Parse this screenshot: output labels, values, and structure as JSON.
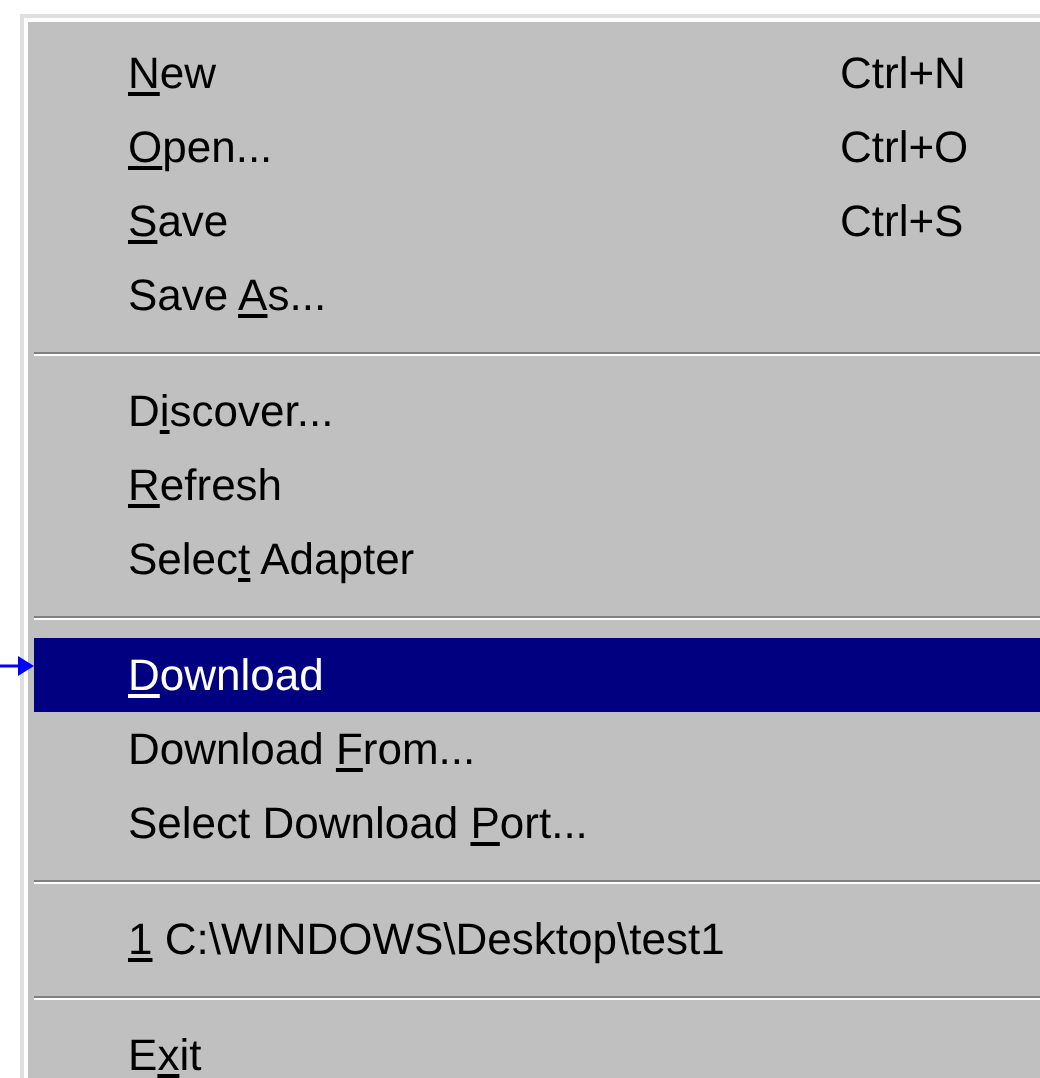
{
  "menu": {
    "sections": [
      {
        "items": [
          {
            "key": "N",
            "after": "ew",
            "shortcut": "Ctrl+N",
            "selected": false
          },
          {
            "key": "O",
            "after": "pen...",
            "shortcut": "Ctrl+O",
            "selected": false
          },
          {
            "key": "S",
            "after": "ave",
            "shortcut": "Ctrl+S",
            "selected": false
          },
          {
            "before": "Save ",
            "key": "A",
            "after": "s...",
            "selected": false
          }
        ]
      },
      {
        "items": [
          {
            "before": "D",
            "key": "i",
            "after": "scover...",
            "selected": false
          },
          {
            "key": "R",
            "after": "efresh",
            "selected": false
          },
          {
            "before": "Selec",
            "key": "t",
            "after": " Adapter",
            "selected": false
          }
        ]
      },
      {
        "items": [
          {
            "key": "D",
            "after": "ownload",
            "selected": true
          },
          {
            "before": "Download ",
            "key": "F",
            "after": "rom...",
            "selected": false
          },
          {
            "before": "Select Download ",
            "key": "P",
            "after": "ort...",
            "selected": false
          }
        ]
      },
      {
        "items": [
          {
            "key": "1",
            "after": " C:\\WINDOWS\\Desktop\\test1",
            "selected": false
          }
        ]
      },
      {
        "items": [
          {
            "before": "E",
            "key": "x",
            "after": "it",
            "selected": false
          }
        ]
      }
    ]
  }
}
